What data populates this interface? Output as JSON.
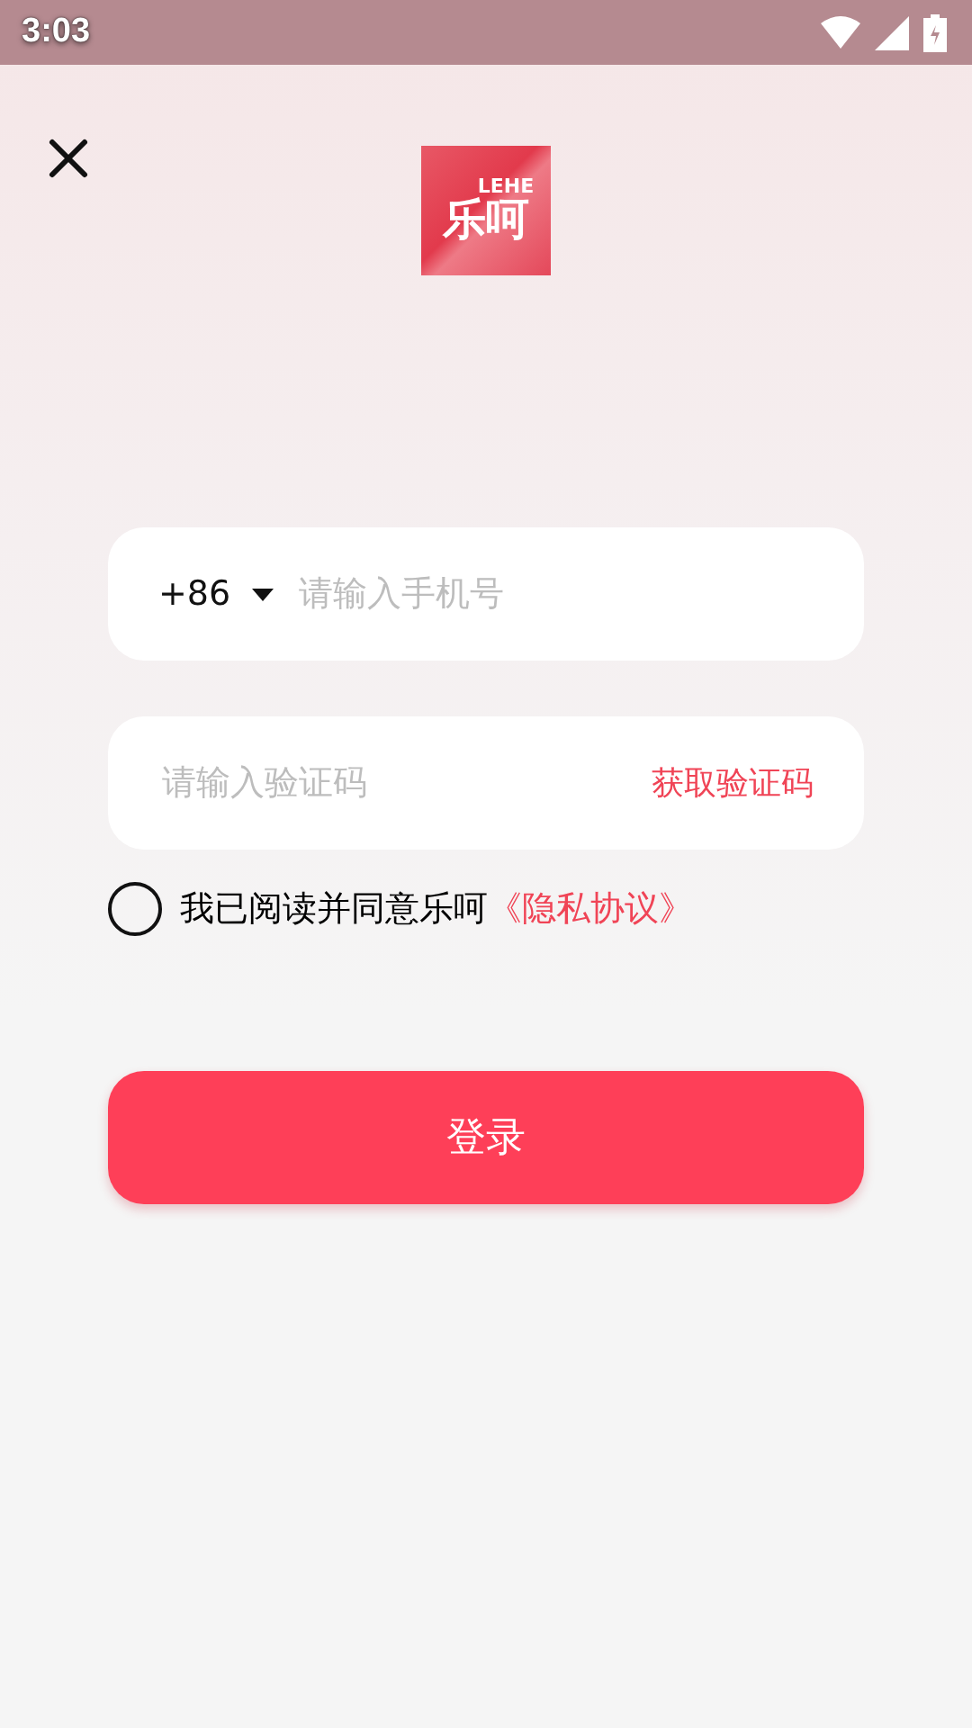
{
  "status_bar": {
    "time": "3:03"
  },
  "logo": {
    "brand": "LEHE",
    "mark": "乐呵"
  },
  "phone_field": {
    "country_code": "+86",
    "placeholder": "请输入手机号"
  },
  "code_field": {
    "placeholder": "请输入验证码",
    "action": "获取验证码"
  },
  "agreement": {
    "checked": false,
    "text": "我已阅读并同意乐呵",
    "link": "《隐私协议》"
  },
  "login_button": {
    "label": "登录"
  }
}
